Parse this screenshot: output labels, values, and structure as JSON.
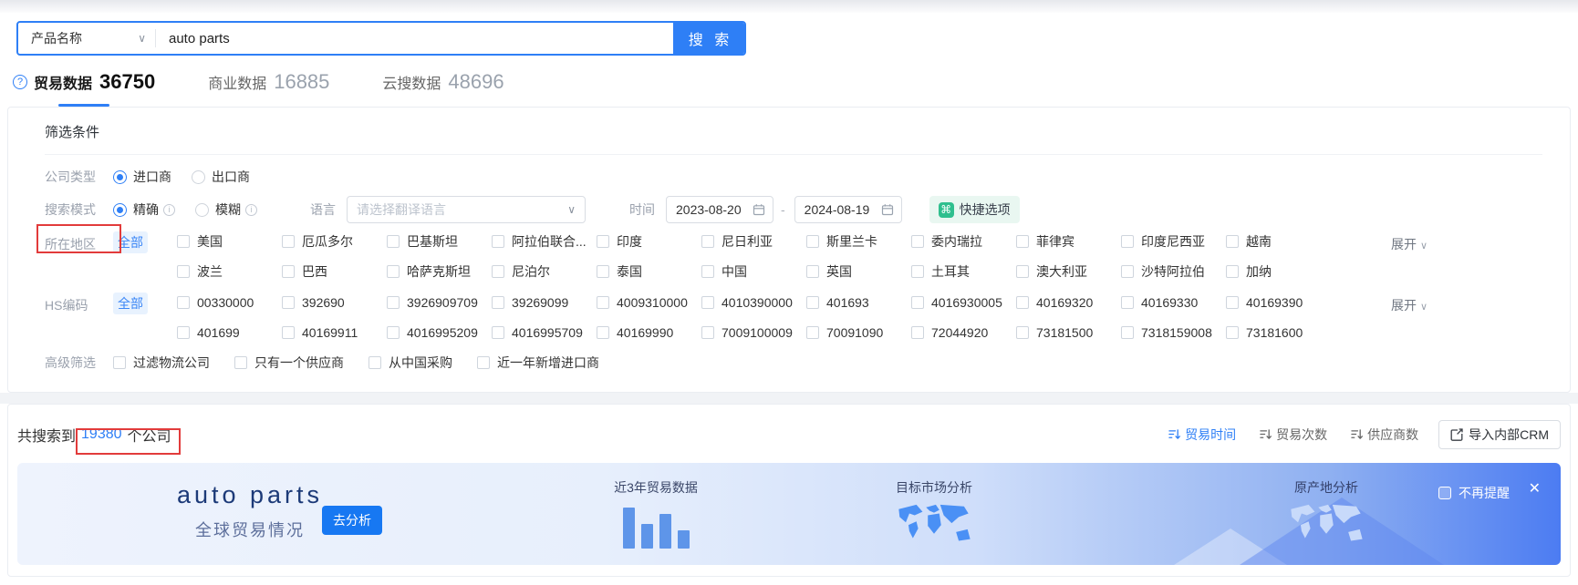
{
  "search": {
    "category_selector": "产品名称",
    "query": "auto parts",
    "search_button": "搜 索"
  },
  "tabs": [
    {
      "label": "贸易数据",
      "count": "36750"
    },
    {
      "label": "商业数据",
      "count": "16885"
    },
    {
      "label": "云搜数据",
      "count": "48696"
    }
  ],
  "filter": {
    "title": "筛选条件",
    "company_type": {
      "label": "公司类型",
      "options": [
        {
          "label": "进口商"
        },
        {
          "label": "出口商"
        }
      ]
    },
    "search_mode": {
      "label": "搜索模式",
      "options": [
        {
          "label": "精确"
        },
        {
          "label": "模糊"
        }
      ]
    },
    "language": {
      "label": "语言",
      "placeholder": "请选择翻译语言"
    },
    "time": {
      "label": "时间",
      "start": "2023-08-20",
      "end": "2024-08-19"
    },
    "quick_option": "快捷选项",
    "region": {
      "label": "所在地区",
      "all": "全部",
      "expand": "展开",
      "row1": [
        "美国",
        "厄瓜多尔",
        "巴基斯坦",
        "阿拉伯联合...",
        "印度",
        "尼日利亚",
        "斯里兰卡",
        "委内瑞拉",
        "菲律宾",
        "印度尼西亚",
        "越南"
      ],
      "row2": [
        "波兰",
        "巴西",
        "哈萨克斯坦",
        "尼泊尔",
        "泰国",
        "中国",
        "英国",
        "土耳其",
        "澳大利亚",
        "沙特阿拉伯",
        "加纳"
      ]
    },
    "hs_code": {
      "label": "HS编码",
      "all": "全部",
      "expand": "展开",
      "row1": [
        "00330000",
        "392690",
        "3926909709",
        "39269099",
        "4009310000",
        "4010390000",
        "401693",
        "4016930005",
        "40169320",
        "40169330",
        "40169390"
      ],
      "row2": [
        "401699",
        "40169911",
        "4016995209",
        "4016995709",
        "40169990",
        "7009100009",
        "70091090",
        "72044920",
        "73181500",
        "7318159008",
        "73181600"
      ]
    },
    "advanced": {
      "label": "高级筛选",
      "options": [
        "过滤物流公司",
        "只有一个供应商",
        "从中国采购",
        "近一年新增进口商"
      ]
    }
  },
  "results": {
    "prefix": "共搜索到",
    "count": "19380",
    "suffix": "个公司",
    "sorts": [
      "贸易时间",
      "贸易次数",
      "供应商数"
    ],
    "crm_button": "导入内部CRM"
  },
  "banner": {
    "title": "auto parts",
    "subtitle": "全球贸易情况",
    "analyze_button": "去分析",
    "card_trade": "近3年贸易数据",
    "card_market": "目标市场分析",
    "card_origin": "原产地分析",
    "dismiss": "不再提醒"
  },
  "icons": {
    "chevron_down": "∨",
    "question_mark": "?",
    "info": "i",
    "command": "⌘",
    "close": "✕",
    "date_separator": "-"
  },
  "colors": {
    "accent_blue": "#2e7ff6",
    "annotation_red": "#e23b3b",
    "quick_green": "#2fbf8e",
    "banner_deep_blue": "#4c7cf2"
  }
}
